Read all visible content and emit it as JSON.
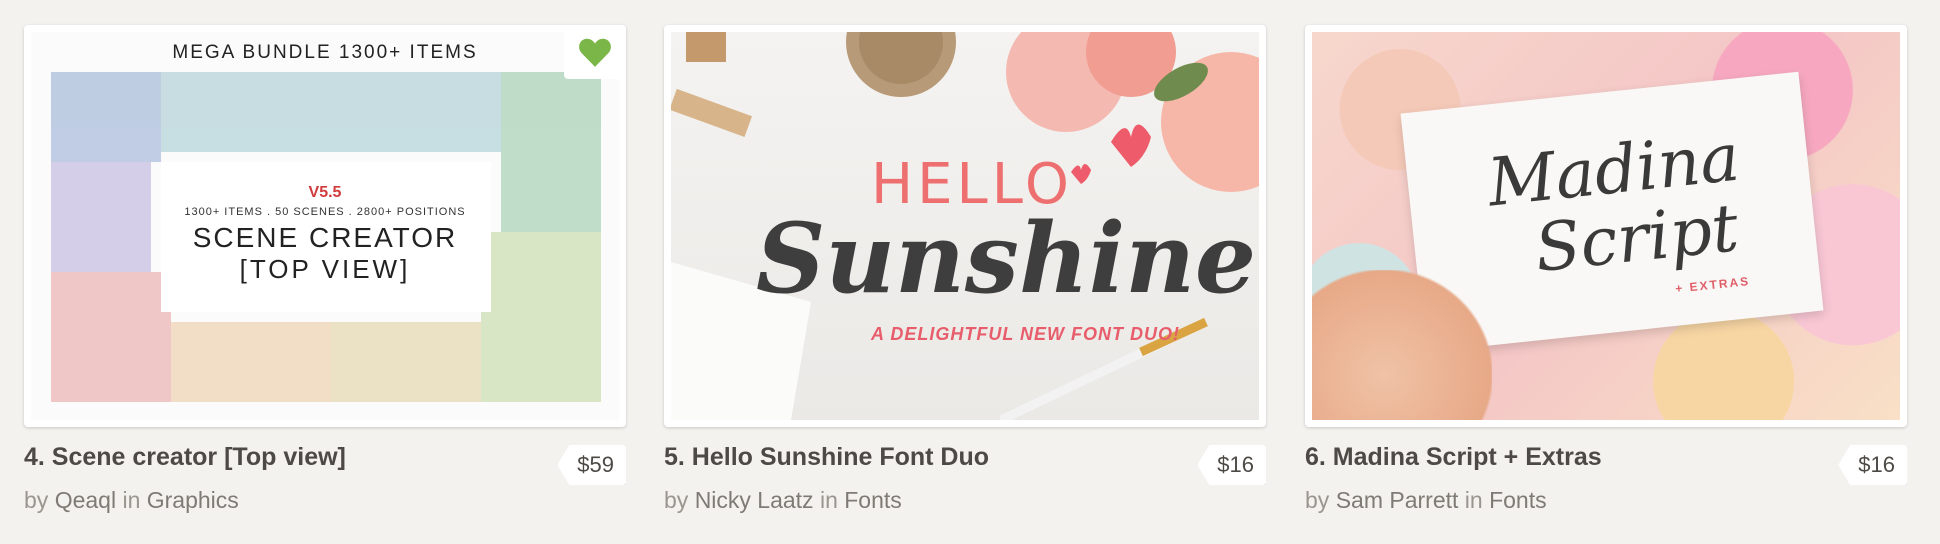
{
  "products": [
    {
      "title": "4. Scene creator [Top view]",
      "by_label": "by",
      "author": "Qeaql",
      "in_label": "in",
      "category": "Graphics",
      "price": "$59",
      "favorited": true,
      "favorite_color": "#7ab648",
      "art": {
        "banner": "MEGA BUNDLE 1300+ ITEMS",
        "version": "V5.5",
        "subline": "1300+ ITEMS . 50 SCENES . 2800+ POSITIONS",
        "heading": "SCENE CREATOR",
        "heading2": "[TOP VIEW]"
      }
    },
    {
      "title": "5. Hello Sunshine Font Duo",
      "by_label": "by",
      "author": "Nicky Laatz",
      "in_label": "in",
      "category": "Fonts",
      "price": "$16",
      "art": {
        "hello": "HELLO",
        "main": "Sunshine",
        "tagline": "A DELIGHTFUL NEW FONT DUO!"
      }
    },
    {
      "title": "6. Madina Script + Extras",
      "by_label": "by",
      "author": "Sam Parrett",
      "in_label": "in",
      "category": "Fonts",
      "price": "$16",
      "art": {
        "line1": "Madina",
        "line2": "Script",
        "extra": "+ EXTRAS"
      }
    }
  ]
}
